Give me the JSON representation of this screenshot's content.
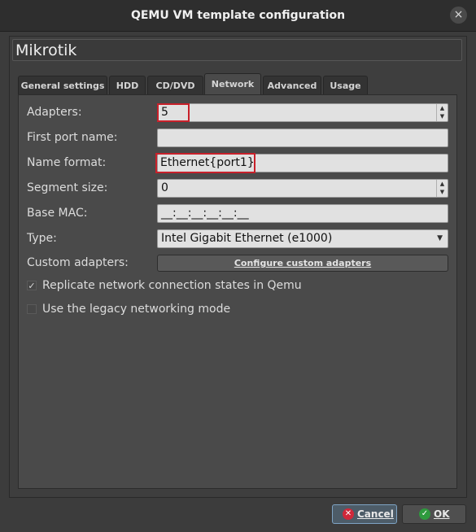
{
  "window": {
    "title": "QEMU VM template configuration",
    "close_icon": "×"
  },
  "template_name": "Mikrotik",
  "tabs": [
    {
      "label": "General settings"
    },
    {
      "label": "HDD"
    },
    {
      "label": "CD/DVD"
    },
    {
      "label": "Network"
    },
    {
      "label": "Advanced"
    },
    {
      "label": "Usage"
    }
  ],
  "active_tab": "Network",
  "network": {
    "adapters_label": "Adapters:",
    "adapters_value": "5",
    "first_port_name_label": "First port name:",
    "first_port_name_value": "",
    "name_format_label": "Name format:",
    "name_format_value": "Ethernet{port1}",
    "segment_size_label": "Segment size:",
    "segment_size_value": "0",
    "base_mac_label": "Base MAC:",
    "base_mac_value": "__:__:__:__:__:__",
    "type_label": "Type:",
    "type_value": "Intel Gigabit Ethernet (e1000)",
    "custom_adapters_label": "Custom adapters:",
    "configure_button": "Configure custom adapters",
    "replicate_label": "Replicate network connection states in Qemu",
    "replicate_checked": true,
    "legacy_label": "Use the legacy networking mode",
    "legacy_checked": false,
    "check_mark": "✓"
  },
  "buttons": {
    "cancel": "Cancel",
    "ok": "OK",
    "cancel_icon": "✕",
    "ok_icon": "✓"
  },
  "colors": {
    "highlight": "#c8202a",
    "cancel_icon": "#d0283a",
    "ok_icon": "#2e9a3e"
  }
}
